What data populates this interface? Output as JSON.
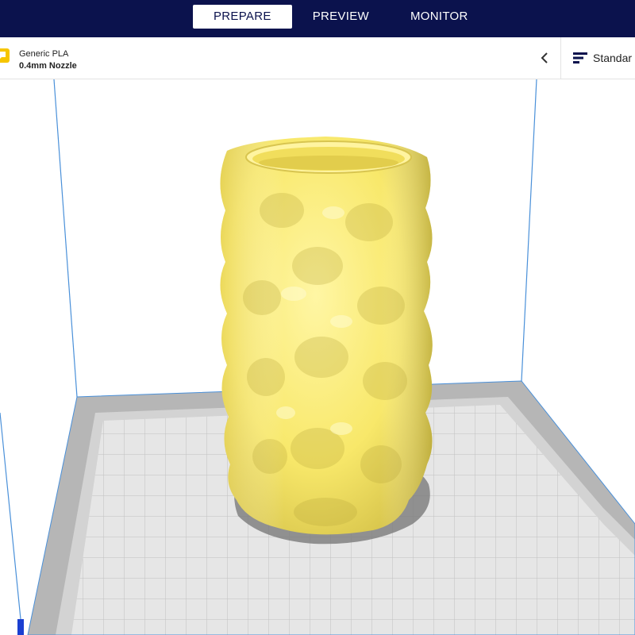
{
  "stages": [
    {
      "label": "PREPARE",
      "active": true
    },
    {
      "label": "PREVIEW",
      "active": false
    },
    {
      "label": "MONITOR",
      "active": false
    }
  ],
  "printer_setup": {
    "material": "Generic PLA",
    "nozzle": "0.4mm Nozzle",
    "material_icon": "spool-icon",
    "collapse_icon": "chevron-left-icon"
  },
  "print_settings": {
    "profile": "Standar",
    "icon": "settings-sliders-icon"
  },
  "scene": {
    "object": "Vase",
    "object_color": "#f8e86a",
    "build_plate_color": "#e5e5e5",
    "grid_color": "#c4c4c4",
    "edge_color": "#4a90d9",
    "accent": "#0b124d"
  }
}
